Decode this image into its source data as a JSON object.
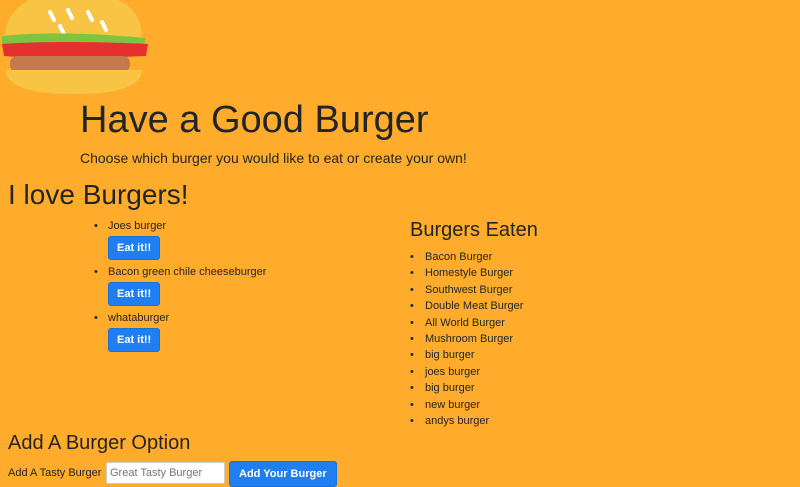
{
  "header": {
    "logo_icon": "burger-icon",
    "title": "Have a Good Burger",
    "lead": "Choose which burger you would like to eat or create your own!"
  },
  "love": {
    "title": "I love Burgers!",
    "items": [
      {
        "name": "Joes burger",
        "button_label": "Eat it!!"
      },
      {
        "name": "Bacon green chile cheeseburger",
        "button_label": "Eat it!!"
      },
      {
        "name": "whataburger",
        "button_label": "Eat it!!"
      }
    ]
  },
  "eaten": {
    "title": "Burgers Eaten",
    "items": [
      "Bacon Burger",
      "Homestyle Burger",
      "Southwest Burger",
      "Double Meat Burger",
      "All World Burger",
      "Mushroom Burger",
      "big burger",
      "joes burger",
      "big burger",
      "new burger",
      "andys burger"
    ]
  },
  "add": {
    "title": "Add A Burger Option",
    "label": "Add A Tasty Burger",
    "placeholder": "Great Tasty Burger",
    "value": "",
    "button_label": "Add Your Burger"
  },
  "colors": {
    "background": "#ffac2c",
    "button": "#1f7ff2",
    "button_text": "#ffffff",
    "text": "#212529"
  }
}
